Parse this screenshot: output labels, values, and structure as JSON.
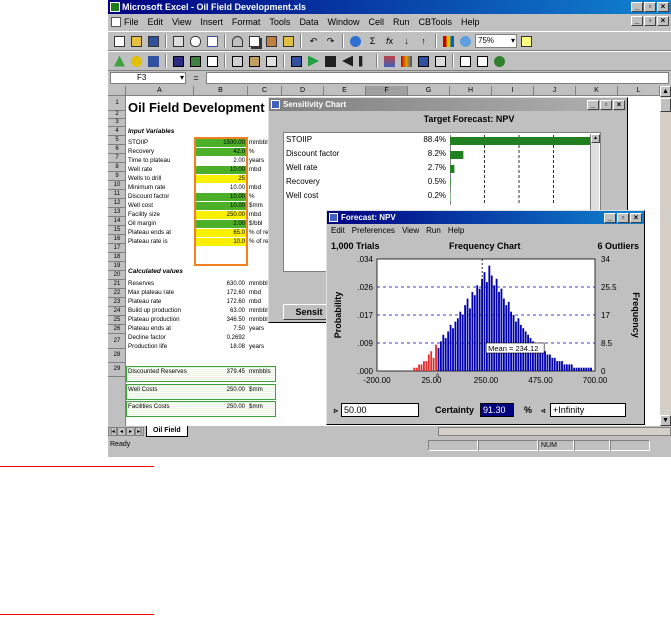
{
  "window": {
    "title": "Microsoft Excel - Oil Field Development.xls",
    "min": "_",
    "max": "▫",
    "close": "×"
  },
  "menu": [
    "File",
    "Edit",
    "View",
    "Insert",
    "Format",
    "Tools",
    "Data",
    "Window",
    "Cell",
    "Run",
    "CBTools",
    "Help"
  ],
  "toolbar": {
    "zoom": "75%"
  },
  "formula": {
    "cell_ref": "F3",
    "equals": "="
  },
  "columns": [
    "A",
    "B",
    "C",
    "D",
    "E",
    "F",
    "G",
    "H",
    "I",
    "J",
    "K",
    "L"
  ],
  "rows": [
    "1",
    "2",
    "3",
    "4",
    "5",
    "6",
    "7",
    "8",
    "9",
    "10",
    "11",
    "12",
    "13",
    "14",
    "15",
    "16",
    "17",
    "18",
    "19",
    "20",
    "21",
    "22",
    "23",
    "24",
    "25",
    "26",
    "27",
    "28",
    "29"
  ],
  "sheet": {
    "title": "Oil Field Development",
    "input_header": "Input Variables",
    "inputs": [
      {
        "label": "STOIIP",
        "value": "1500.00",
        "unit": "mmbbls",
        "color": "g"
      },
      {
        "label": "Recovery",
        "value": "42.0",
        "unit": "%",
        "color": "g"
      },
      {
        "label": "Time to plateau",
        "value": "2.00",
        "unit": "years",
        "color": ""
      },
      {
        "label": "Well rate",
        "value": "10.00",
        "unit": "mbd",
        "color": "g"
      },
      {
        "label": "Wells to drill",
        "value": "25",
        "unit": "",
        "color": "y"
      },
      {
        "label": "Minimum rate",
        "value": "10.00",
        "unit": "mbd",
        "color": ""
      },
      {
        "label": "Discount factor",
        "value": "10.00",
        "unit": "%",
        "color": "g"
      },
      {
        "label": "Well cost",
        "value": "10.00",
        "unit": "$mm",
        "color": "g"
      },
      {
        "label": "Facility size",
        "value": "250.00",
        "unit": "mbd",
        "color": "y"
      },
      {
        "label": "Oil margin",
        "value": "2.00",
        "unit": "$/bbl",
        "color": "g"
      },
      {
        "label": "Plateau ends at",
        "value": "65.0",
        "unit": "% of res",
        "color": "y"
      },
      {
        "label": "Plateau rate is",
        "value": "10.0",
        "unit": "% of res",
        "color": "y"
      }
    ],
    "calc_header": "Calculated values",
    "calcs": [
      {
        "label": "Reserves",
        "value": "630.00",
        "unit": "mmbbls"
      },
      {
        "label": "Max plateau rate",
        "value": "172.60",
        "unit": "mbd"
      },
      {
        "label": "Plateau rate",
        "value": "172.60",
        "unit": "mbd"
      },
      {
        "label": "Build up production",
        "value": "63.00",
        "unit": "mmbbls"
      },
      {
        "label": "Plateau production",
        "value": "346.50",
        "unit": "mmbbls"
      },
      {
        "label": "Plateau ends at",
        "value": "7.50",
        "unit": "years"
      },
      {
        "label": "Decline factor",
        "value": "0.2692",
        "unit": ""
      },
      {
        "label": "Production life",
        "value": "18.08",
        "unit": "years"
      }
    ],
    "outputs": [
      {
        "label": "Discounted Reserves",
        "value": "379.45",
        "unit": "mmbbls"
      },
      {
        "label": "Well Costs",
        "value": "250.00",
        "unit": "$mm"
      },
      {
        "label": "Facilities Costs",
        "value": "250.00",
        "unit": "$mm"
      }
    ],
    "tab_name": "Oil Field"
  },
  "status": {
    "ready": "Ready",
    "num": "NUM"
  },
  "sensitivity": {
    "title": "Sensitivity Chart",
    "heading": "Target Forecast:  NPV",
    "items": [
      {
        "label": "STOIIP",
        "pct": "88.4%",
        "value": 88.4
      },
      {
        "label": "Discount factor",
        "pct": "8.2%",
        "value": 8.2
      },
      {
        "label": "Well rate",
        "pct": "2.7%",
        "value": 2.7
      },
      {
        "label": "Recovery",
        "pct": "0.5%",
        "value": 0.5
      },
      {
        "label": "Well cost",
        "pct": "0.2%",
        "value": 0.2
      }
    ],
    "button": "Sensit"
  },
  "forecast": {
    "title": "Forecast:  NPV",
    "menu": [
      "Edit",
      "Preferences",
      "View",
      "Run",
      "Help"
    ],
    "trials": "1,000 Trials",
    "chart_title": "Frequency Chart",
    "outliers": "6 Outliers",
    "left_axis_label": "Probability",
    "right_axis_label": "Frequency",
    "mean_label": "Mean = 234.12",
    "lower_input": "50.00",
    "certainty_label": "Certainty",
    "certainty_value": "91.30",
    "pct_sign": "%",
    "upper_input": "+Infinity"
  },
  "chart_data": {
    "type": "bar",
    "title": "Frequency Chart",
    "xlabel": "",
    "ylabel": "Probability",
    "y2label": "Frequency",
    "x_ticks": [
      "-200.00",
      "25.00",
      "250.00",
      "475.00",
      "700.00"
    ],
    "x_range": [
      -200,
      700
    ],
    "y_ticks": [
      ".000",
      ".009",
      ".017",
      ".026",
      ".034"
    ],
    "y_range": [
      0,
      0.034
    ],
    "y2_ticks": [
      "0",
      "8.5",
      "17",
      "25.5",
      "34"
    ],
    "y2_range": [
      0,
      34
    ],
    "mean": 234.12,
    "certainty_lower": 50,
    "bin_width": 10,
    "bin_starts": [
      -50,
      -40,
      -30,
      -20,
      -10,
      0,
      10,
      20,
      30,
      40,
      50,
      60,
      70,
      80,
      90,
      100,
      110,
      120,
      130,
      140,
      150,
      160,
      170,
      180,
      190,
      200,
      210,
      220,
      230,
      240,
      250,
      260,
      270,
      280,
      290,
      300,
      310,
      320,
      330,
      340,
      350,
      360,
      370,
      380,
      390,
      400,
      410,
      420,
      430,
      440,
      450,
      460,
      470,
      480,
      490,
      500,
      510,
      520,
      530,
      540,
      550,
      560,
      570,
      580,
      590,
      600,
      610,
      620,
      630,
      640,
      650,
      660,
      670,
      680
    ],
    "frequencies": [
      1,
      1,
      2,
      2,
      3,
      3,
      5,
      6,
      4,
      8,
      7,
      9,
      11,
      10,
      12,
      14,
      13,
      15,
      16,
      18,
      17,
      20,
      22,
      19,
      24,
      23,
      26,
      25,
      28,
      30,
      27,
      32,
      29,
      26,
      28,
      24,
      25,
      22,
      20,
      21,
      18,
      17,
      15,
      16,
      14,
      13,
      12,
      11,
      10,
      9,
      8,
      8,
      7,
      6,
      6,
      5,
      5,
      4,
      4,
      3,
      3,
      3,
      2,
      2,
      2,
      2,
      1,
      1,
      1,
      1,
      1,
      1,
      1,
      1
    ]
  }
}
